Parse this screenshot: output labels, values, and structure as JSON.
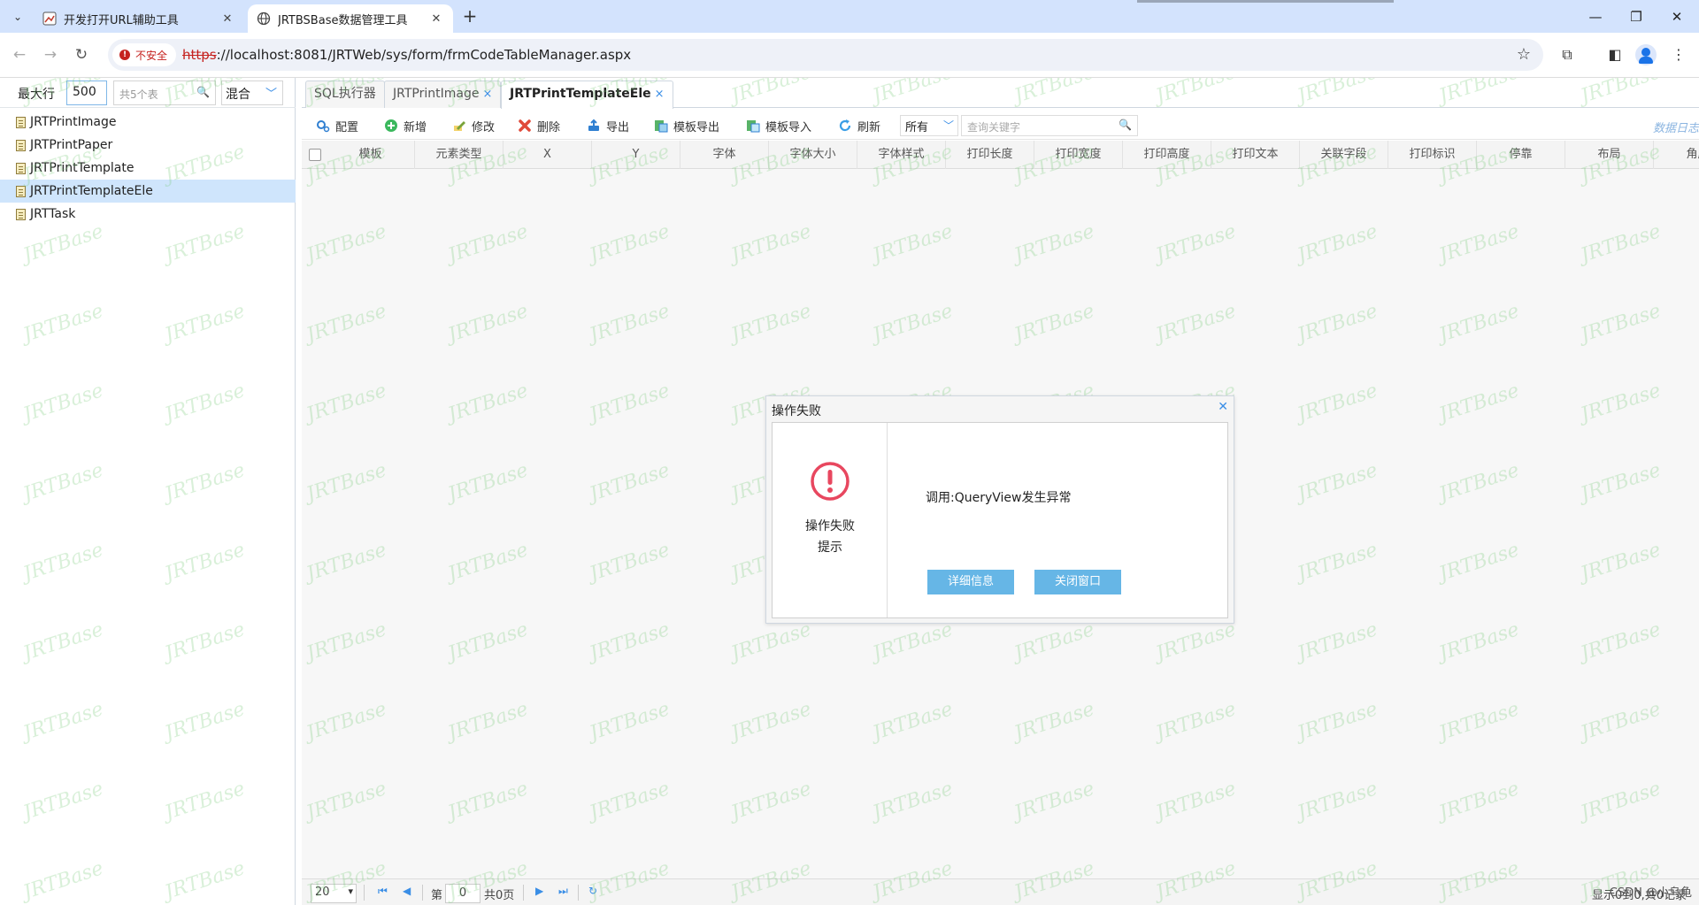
{
  "browser": {
    "tabs": [
      {
        "title": "开发打开URL辅助工具",
        "active": false
      },
      {
        "title": "JRTBSBase数据管理工具",
        "active": true
      }
    ],
    "new_tab_label": "+",
    "security_label": "不安全",
    "url_scheme": "https",
    "url_rest": "://localhost:8081/JRTWeb/sys/form/frmCodeTableManager.aspx"
  },
  "left_panel": {
    "max_rows_label": "最大行",
    "max_rows_value": "500",
    "search_placeholder": "共5个表",
    "mode_value": "混合",
    "tables": [
      {
        "name": "JRTPrintImage",
        "selected": false
      },
      {
        "name": "JRTPrintPaper",
        "selected": false
      },
      {
        "name": "JRTPrintTemplate",
        "selected": false
      },
      {
        "name": "JRTPrintTemplateEle",
        "selected": true
      },
      {
        "name": "JRTTask",
        "selected": false
      }
    ]
  },
  "content_tabs": [
    {
      "label": "SQL执行器",
      "closable": false,
      "active": false
    },
    {
      "label": "JRTPrintImage",
      "closable": true,
      "active": false
    },
    {
      "label": "JRTPrintTemplateEle",
      "closable": true,
      "active": true
    }
  ],
  "grid_toolbar": {
    "buttons": {
      "config": "配置",
      "add": "新增",
      "edit": "修改",
      "delete": "删除",
      "export": "导出",
      "template_export": "模板导出",
      "template_import": "模板导入",
      "refresh": "刷新"
    },
    "filter_value": "所有",
    "search_placeholder": "查询关键字",
    "log_link": "数据日志"
  },
  "grid": {
    "columns": [
      "模板",
      "元素类型",
      "X",
      "Y",
      "字体",
      "字体大小",
      "字体样式",
      "打印长度",
      "打印宽度",
      "打印高度",
      "打印文本",
      "关联字段",
      "打印标识",
      "停靠",
      "布局",
      "角度"
    ]
  },
  "pager": {
    "page_size": "20",
    "page_prefix": "第",
    "page_value": "0",
    "page_suffix": "共0页",
    "info": "显示0到0,共0记录"
  },
  "dialog": {
    "title": "操作失败",
    "caption_line1": "操作失败",
    "caption_line2": "提示",
    "message": "调用:QueryView发生异常",
    "detail_button": "详细信息",
    "close_button": "关闭窗口"
  },
  "watermark_text": "JRTBase",
  "csdn_mark": "CSDN @小乌龟",
  "colors": {
    "accent": "#3a8ee6",
    "dialog_button": "#66b6e6",
    "error": "#e8475f",
    "selected_row": "#cfe5fc"
  }
}
